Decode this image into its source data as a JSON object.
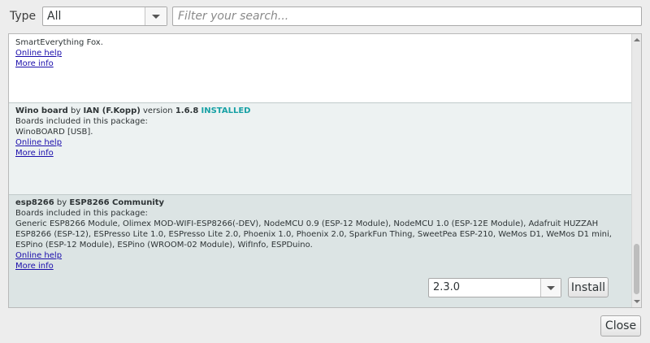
{
  "filter": {
    "type_label": "Type",
    "type_value": "All",
    "search_placeholder": "Filter your search..."
  },
  "items": [
    {
      "partial_text": "SmartEverything Fox.",
      "online_help": "Online help",
      "more_info": "More info"
    },
    {
      "name": "Wino board",
      "by": "by",
      "author": "IAN (F.Kopp)",
      "version_word": "version",
      "version": "1.6.8",
      "status": "INSTALLED",
      "boards_heading": "Boards included in this package:",
      "boards": "WinoBOARD [USB].",
      "online_help": "Online help",
      "more_info": "More info"
    },
    {
      "name": "esp8266",
      "by": "by",
      "author": "ESP8266 Community",
      "boards_heading": "Boards included in this package:",
      "boards_line1": "Generic ESP8266 Module, Olimex MOD-WIFI-ESP8266(-DEV), NodeMCU 0.9 (ESP-12 Module), NodeMCU 1.0 (ESP-12E Module), Adafruit HUZZAH",
      "boards_line2": "ESP8266 (ESP-12), ESPresso Lite 1.0, ESPresso Lite 2.0, Phoenix 1.0, Phoenix 2.0, SparkFun Thing, SweetPea ESP-210, WeMos D1, WeMos D1 mini,",
      "boards_line3": "ESPino (ESP-12 Module), ESPino (WROOM-02 Module), WifInfo, ESPDuino.",
      "online_help": "Online help",
      "more_info": "More info",
      "selected_version": "2.3.0",
      "install_label": "Install"
    }
  ],
  "close_label": "Close",
  "colors": {
    "installed": "#17a1a5",
    "link": "#1a0dab",
    "selected_row": "#dce4e4",
    "alt_row": "#edf2f2"
  }
}
